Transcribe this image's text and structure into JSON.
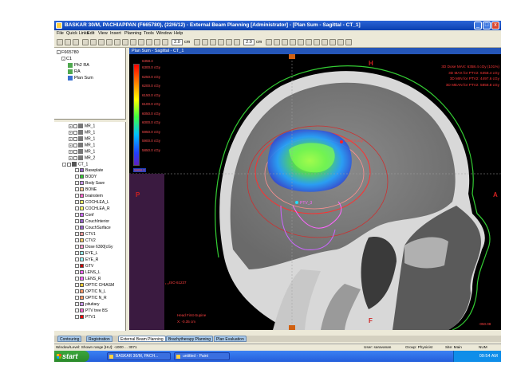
{
  "window": {
    "title": "BASKAR  30/M, PACHIAPPAN (F665780), (22/6/12) - External Beam Planning [Administrator] - [Plan Sum - Sagittal - CT_1]",
    "controls": [
      "_",
      "□",
      "x"
    ]
  },
  "menu": [
    "File",
    "Quick Links",
    "Edit",
    "View",
    "Insert",
    "Planning",
    "Tools",
    "Window",
    "Help"
  ],
  "toolbar": {
    "field1_value": "2.0",
    "field1_unit": "cm",
    "field2_value": "2.0",
    "field2_unit": "cm"
  },
  "patient_tree": {
    "patient_id": "F665780",
    "course": "C1",
    "items": [
      "Ph2 RA",
      "RA",
      "Plan Sum"
    ]
  },
  "structure_tree": {
    "image_items": [
      "MR_1",
      "MR_1",
      "MR_1",
      "MR_1",
      "MR_1",
      "MR_2"
    ],
    "ct_name": "CT_1",
    "structures": [
      {
        "name": "Baseplate",
        "color": "#9966cc"
      },
      {
        "name": "BODY",
        "color": "#33cc33"
      },
      {
        "name": "Body Save",
        "color": "#cc99ff"
      },
      {
        "name": "BONE",
        "color": "#ffcc99"
      },
      {
        "name": "brainstem",
        "color": "#ff66cc"
      },
      {
        "name": "COCHLEA_L",
        "color": "#ffff66"
      },
      {
        "name": "COCHLEA_R",
        "color": "#ffff66"
      },
      {
        "name": "Conf",
        "color": "#cc66ff"
      },
      {
        "name": "CouchInterior",
        "color": "#9966cc"
      },
      {
        "name": "CouchSurface",
        "color": "#9966cc"
      },
      {
        "name": "CTV1",
        "color": "#ff9999"
      },
      {
        "name": "CTV2",
        "color": "#ffcc66"
      },
      {
        "name": "Dose 6300[cGy",
        "color": "#ff99cc"
      },
      {
        "name": "EYE_L",
        "color": "#99ffff"
      },
      {
        "name": "EYE_R",
        "color": "#99ffff"
      },
      {
        "name": "GTV",
        "color": "#cc0000"
      },
      {
        "name": "LENS_L",
        "color": "#ff66ff"
      },
      {
        "name": "LENS_R",
        "color": "#ff66ff"
      },
      {
        "name": "OPTIC CHIASM",
        "color": "#ffcc33"
      },
      {
        "name": "OPTIC N_L",
        "color": "#ff9966"
      },
      {
        "name": "OPTIC N_R",
        "color": "#ff9966"
      },
      {
        "name": "pituitary",
        "color": "#cc99ff"
      },
      {
        "name": "PTV tree BS",
        "color": "#ff66cc"
      },
      {
        "name": "PTV1",
        "color": "#ff0000"
      }
    ]
  },
  "viewer": {
    "header": "Plan Sum - Sagittal - CT_1",
    "colorbar_top": "6358.4",
    "colorbar_labels": [
      "6300.0 cGy",
      "6250.0 cGy",
      "6200.0 cGy",
      "6150.0 cGy",
      "6100.0 cGy",
      "6050.0 cGy",
      "6000.0 cGy",
      "5950.0 cGy",
      "5900.0 cGy",
      "5850.0 cGy"
    ],
    "colorbar_bottom": "5998.0",
    "dose_readouts": [
      "3D Dose MAX: 6358.4 cGy (101%)",
      "3D MAX for PTV2: 6358.4 cGy",
      "3D MIN for PTV2: 4497.6 cGy",
      "3D MEAN for PTV2: 5858.8 cGy"
    ],
    "orientation": {
      "head": "H",
      "posterior": "P",
      "anterior": "A",
      "foot": "F"
    },
    "max_dose_label": "6358.4 cGy",
    "ptv_label": "PTV_3",
    "iso_label": "ISO 61237",
    "ref_point": "Head First-Supine",
    "slice_info": "X: -0.35 cm",
    "scale_label": "-050.08"
  },
  "workspace_tabs": [
    "Contouring",
    "Registration",
    "External Beam Planning",
    "Brachytherapy Planning",
    "Plan Evaluation"
  ],
  "status": {
    "window_level": "Window/Level: Shown range [HU]: -1000 ... 3071",
    "user": "User: saravanan",
    "group": "Group: Physicist",
    "site": "Site: Main",
    "numlock": "NUM"
  },
  "taskbar": {
    "start": "start",
    "tasks": [
      "BASKAR  30/M, PACH...",
      "untitled - Paint"
    ],
    "clock": "09:54 AM"
  }
}
